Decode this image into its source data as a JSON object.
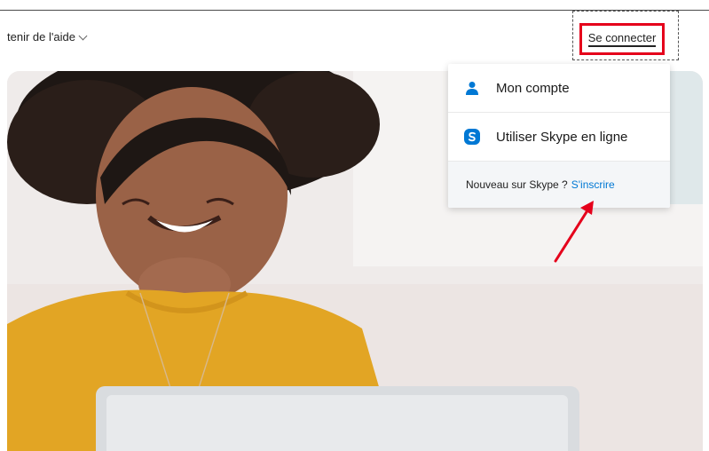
{
  "header": {
    "help_label": "tenir de l'aide",
    "signin_label": "Se connecter"
  },
  "dropdown": {
    "items": [
      {
        "label": "Mon compte",
        "icon": "person-icon"
      },
      {
        "label": "Utiliser Skype en ligne",
        "icon": "skype-icon"
      }
    ],
    "footer_text": "Nouveau sur Skype ?",
    "signup_link": "S'inscrire"
  },
  "colors": {
    "highlight": "#e5001b",
    "link": "#0078d4",
    "skype": "#0078d4"
  }
}
